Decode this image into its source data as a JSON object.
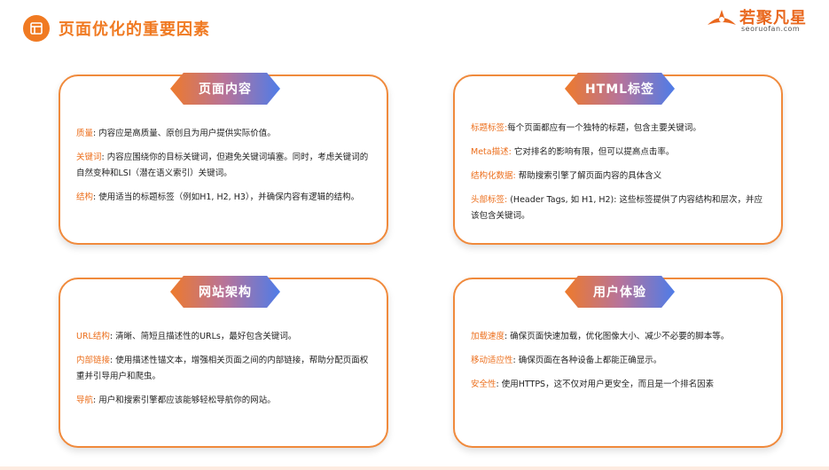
{
  "header": {
    "title": "页面优化的重要因素",
    "logo_text": "若聚凡星",
    "logo_sub": "seoruofan.com"
  },
  "cards": {
    "content": {
      "tag": "页面内容",
      "items": [
        {
          "key": "质量",
          "text": ": 内容应是高质量、原创且为用户提供实际价值。"
        },
        {
          "key": "关键词",
          "text": ": 内容应围绕你的目标关键词，但避免关键词填塞。同时，考虑关键词的自然变种和LSI（潜在语义索引）关键词。"
        },
        {
          "key": "结构",
          "text": ": 使用适当的标题标签（例如H1, H2, H3），并确保内容有逻辑的结构。"
        }
      ]
    },
    "html": {
      "tag": "HTML标签",
      "items": [
        {
          "key": "标题标签:",
          "text": "每个页面都应有一个独特的标题，包含主要关键词。"
        },
        {
          "key": "Meta描述:",
          "text": "   它对排名的影响有限，但可以提高点击率。"
        },
        {
          "key": "结构化数据:",
          "text": "  帮助搜索引擎了解页面内容的具体含义"
        },
        {
          "key": "头部标签:",
          "text": "  (Header Tags, 如 H1, H2): 这些标签提供了内容结构和层次，并应该包含关键词。"
        }
      ]
    },
    "architecture": {
      "tag": "网站架构",
      "items": [
        {
          "key": "URL结构",
          "text": ": 清晰、简短且描述性的URLs，最好包含关键词。"
        },
        {
          "key": "内部链接",
          "text": ": 使用描述性锚文本，增强相关页面之间的内部链接，帮助分配页面权重并引导用户和爬虫。"
        },
        {
          "key": "导航",
          "text": ": 用户和搜索引擎都应该能够轻松导航你的网站。"
        }
      ]
    },
    "ux": {
      "tag": "用户体验",
      "items": [
        {
          "key": "加载速度",
          "text": ": 确保页面快速加载，优化图像大小、减少不必要的脚本等。"
        },
        {
          "key": "移动适应性",
          "text": ": 确保页面在各种设备上都能正确显示。"
        },
        {
          "key": "安全性",
          "text": ": 使用HTTPS，这不仅对用户更安全，而且是一个排名因素"
        }
      ]
    }
  },
  "colors": {
    "accent": "#f07a22",
    "border": "#f08a3c",
    "tag_gradient_start": "#ee7a2c",
    "tag_gradient_end": "#4e7ce8"
  },
  "icons": [
    "document-icon",
    "logo-mark-icon"
  ]
}
